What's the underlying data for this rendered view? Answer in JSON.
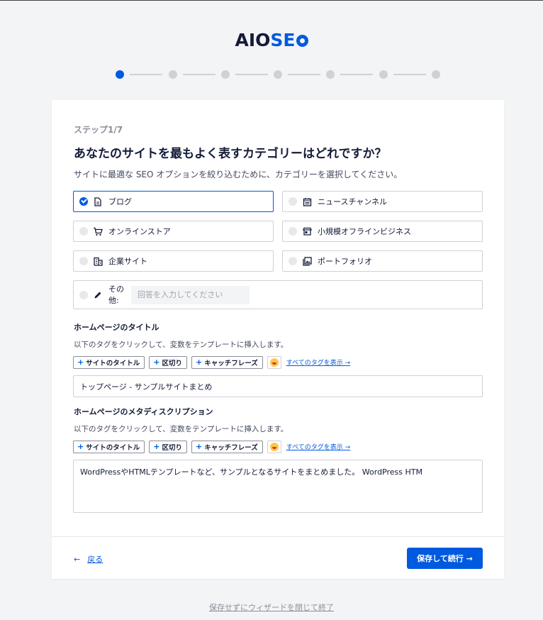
{
  "logo": {
    "part1": "AIO",
    "part2": "SE"
  },
  "wizard": {
    "total_steps": 7,
    "current_step": 1
  },
  "card": {
    "step_label": "ステップ1/7",
    "title": "あなたのサイトを最もよく表すカテゴリーはどれですか？",
    "description": "サイトに最適な SEO オプションを絞り込むために、カテゴリーを選択してください。"
  },
  "categories": [
    {
      "label": "ブログ",
      "icon": "document-icon",
      "selected": true
    },
    {
      "label": "ニュースチャンネル",
      "icon": "calendar-icon",
      "selected": false
    },
    {
      "label": "オンラインストア",
      "icon": "cart-icon",
      "selected": false
    },
    {
      "label": "小規模オフラインビジネス",
      "icon": "store-icon",
      "selected": false
    },
    {
      "label": "企業サイト",
      "icon": "building-icon",
      "selected": false
    },
    {
      "label": "ポートフォリオ",
      "icon": "image-icon",
      "selected": false
    }
  ],
  "other": {
    "label": "その他:",
    "placeholder": "回答を入力してください",
    "icon": "pencil-icon"
  },
  "home_title": {
    "heading": "ホームページのタイトル",
    "description": "以下のタグをクリックして、変数をテンプレートに挿入します。",
    "tags": [
      "サイトのタイトル",
      "区切り",
      "キャッチフレーズ"
    ],
    "all_tags_link": "すべてのタグを表示 →",
    "value": "トップページ - サンプルサイトまとめ"
  },
  "home_description": {
    "heading": "ホームページのメタディスクリプション",
    "description": "以下のタグをクリックして、変数をテンプレートに挿入します。",
    "tags": [
      "サイトのタイトル",
      "区切り",
      "キャッチフレーズ"
    ],
    "all_tags_link": "すべてのタグを表示 →",
    "value": "WordPressやHTMLテンプレートなど、サンプルとなるサイトをまとめました。 WordPress HTM"
  },
  "footer": {
    "back_arrow": "←",
    "back_label": "戻る",
    "save_label": "保存して続行 →"
  },
  "exit_link": "保存せずにウィザードを閉じて終了",
  "colors": {
    "accent": "#005ae0",
    "text": "#141b38",
    "background": "#f3f4f5"
  }
}
